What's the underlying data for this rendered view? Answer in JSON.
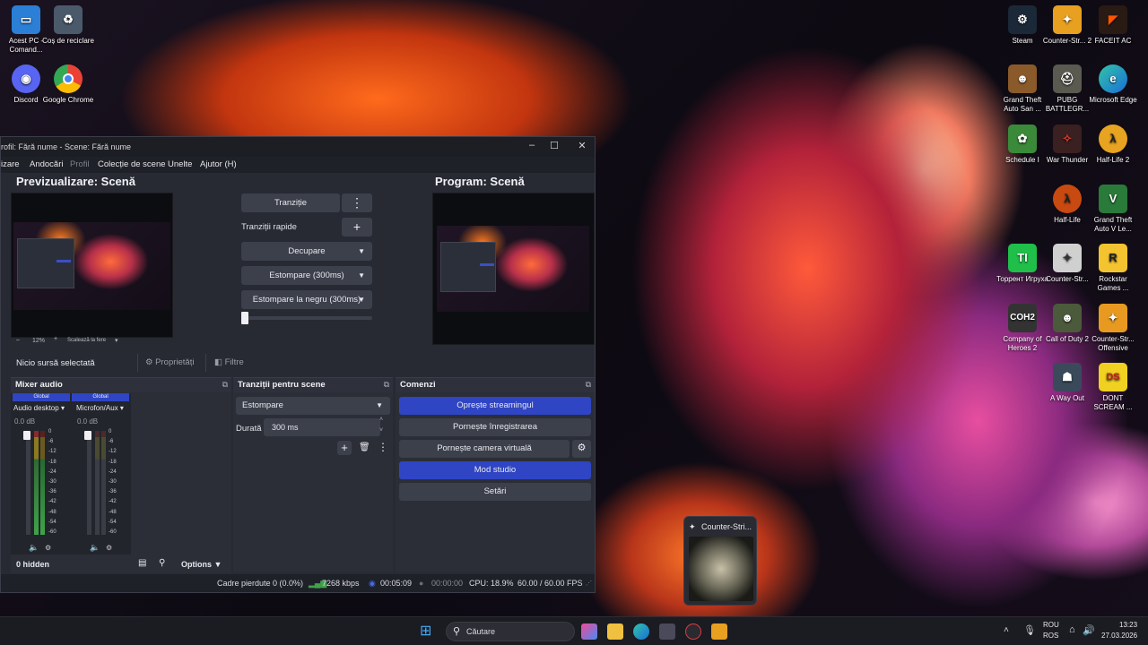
{
  "desktop": {
    "left_icons": [
      {
        "label": "Acest PC - Comand...",
        "icon": "computer-icon"
      },
      {
        "label": "Coș de reciclare",
        "icon": "recycle-bin-icon"
      },
      {
        "label": "Discord",
        "icon": "discord-icon"
      },
      {
        "label": "Google Chrome",
        "icon": "chrome-icon"
      }
    ],
    "right_icons": [
      {
        "label": "Steam",
        "icon": "steam-icon"
      },
      {
        "label": "Counter-Str... 2",
        "icon": "cs2-icon"
      },
      {
        "label": "FACEIT AC",
        "icon": "faceit-icon"
      },
      {
        "label": "Grand Theft Auto San ...",
        "icon": "gta-sa-icon"
      },
      {
        "label": "PUBG BATTLEGR...",
        "icon": "pubg-icon"
      },
      {
        "label": "Microsoft Edge",
        "icon": "edge-icon"
      },
      {
        "label": "Schedule I",
        "icon": "schedule-icon"
      },
      {
        "label": "War Thunder",
        "icon": "war-thunder-icon"
      },
      {
        "label": "Half-Life 2",
        "icon": "half-life-2-icon"
      },
      {
        "label": "Half-Life",
        "icon": "half-life-icon"
      },
      {
        "label": "Grand Theft Auto V Le...",
        "icon": "gta-v-icon"
      },
      {
        "label": "Торрент Игруха",
        "icon": "torrent-icon"
      },
      {
        "label": "Counter-Str...",
        "icon": "cs-icon"
      },
      {
        "label": "Rockstar Games ...",
        "icon": "rockstar-icon"
      },
      {
        "label": "Company of Heroes 2",
        "icon": "coh2-icon"
      },
      {
        "label": "Call of Duty 2",
        "icon": "cod2-icon"
      },
      {
        "label": "Counter-Str... Offensive",
        "icon": "csgo-icon"
      },
      {
        "label": "A Way Out",
        "icon": "a-way-out-icon"
      },
      {
        "label": "DONT SCREAM ...",
        "icon": "dont-scream-icon"
      }
    ]
  },
  "obs": {
    "title": "rofil: Fără nume - Scene: Fără nume",
    "menu": [
      "izare",
      "Andocări",
      "Profil",
      "Colecție de scene",
      "Unelte",
      "Ajutor (H)"
    ],
    "preview_title": "Previzualizare: Scenă",
    "program_title": "Program: Scenă",
    "preview_zoom": "12%",
    "preview_scale_label": "Scalează la fere",
    "transition_button": "Tranziție",
    "quick_transitions_label": "Tranziții rapide",
    "transitions": [
      "Decupare",
      "Estompare (300ms)",
      "Estompare la negru (300ms)"
    ],
    "no_source": "Nicio sursă selectată",
    "properties": "Proprietăți",
    "filters": "Filtre",
    "mixer": {
      "title": "Mixer audio",
      "channels": [
        {
          "tag": "Global",
          "name": "Audio desktop",
          "db": "0.0 dB"
        },
        {
          "tag": "Global",
          "name": "Microfon/Aux",
          "db": "0.0 dB"
        }
      ],
      "ticks": [
        "0",
        "-6",
        "-12",
        "-18",
        "-24",
        "-30",
        "-36",
        "-42",
        "-48",
        "-54",
        "-60"
      ],
      "hidden": "0 hidden",
      "options": "Options"
    },
    "scene_transitions": {
      "title": "Tranziții pentru scene",
      "selected": "Estompare",
      "duration_label": "Durată",
      "duration_value": "300 ms"
    },
    "controls": {
      "title": "Comenzi",
      "stop_stream": "Oprește streamingul",
      "start_record": "Pornește înregistrarea",
      "virtual_cam": "Pornește camera virtuală",
      "studio_mode": "Mod studio",
      "settings": "Setări"
    },
    "status": {
      "dropped": "Cadre pierdute 0 (0.0%)",
      "bitrate": "7268 kbps",
      "stream_time": "00:05:09",
      "record_time": "00:00:00",
      "cpu": "CPU: 18.9%",
      "fps": "60.00 / 60.00 FPS"
    }
  },
  "taskbar": {
    "search_placeholder": "Căutare",
    "lang1": "ROU",
    "lang2": "ROS",
    "time": "13:23",
    "date": "27.03.2026",
    "popup_title": "Counter-Stri..."
  },
  "colors": {
    "obs_bg": "#272a33",
    "accent_blue": "#2f45c4",
    "meter_green": "#3fa34a"
  }
}
